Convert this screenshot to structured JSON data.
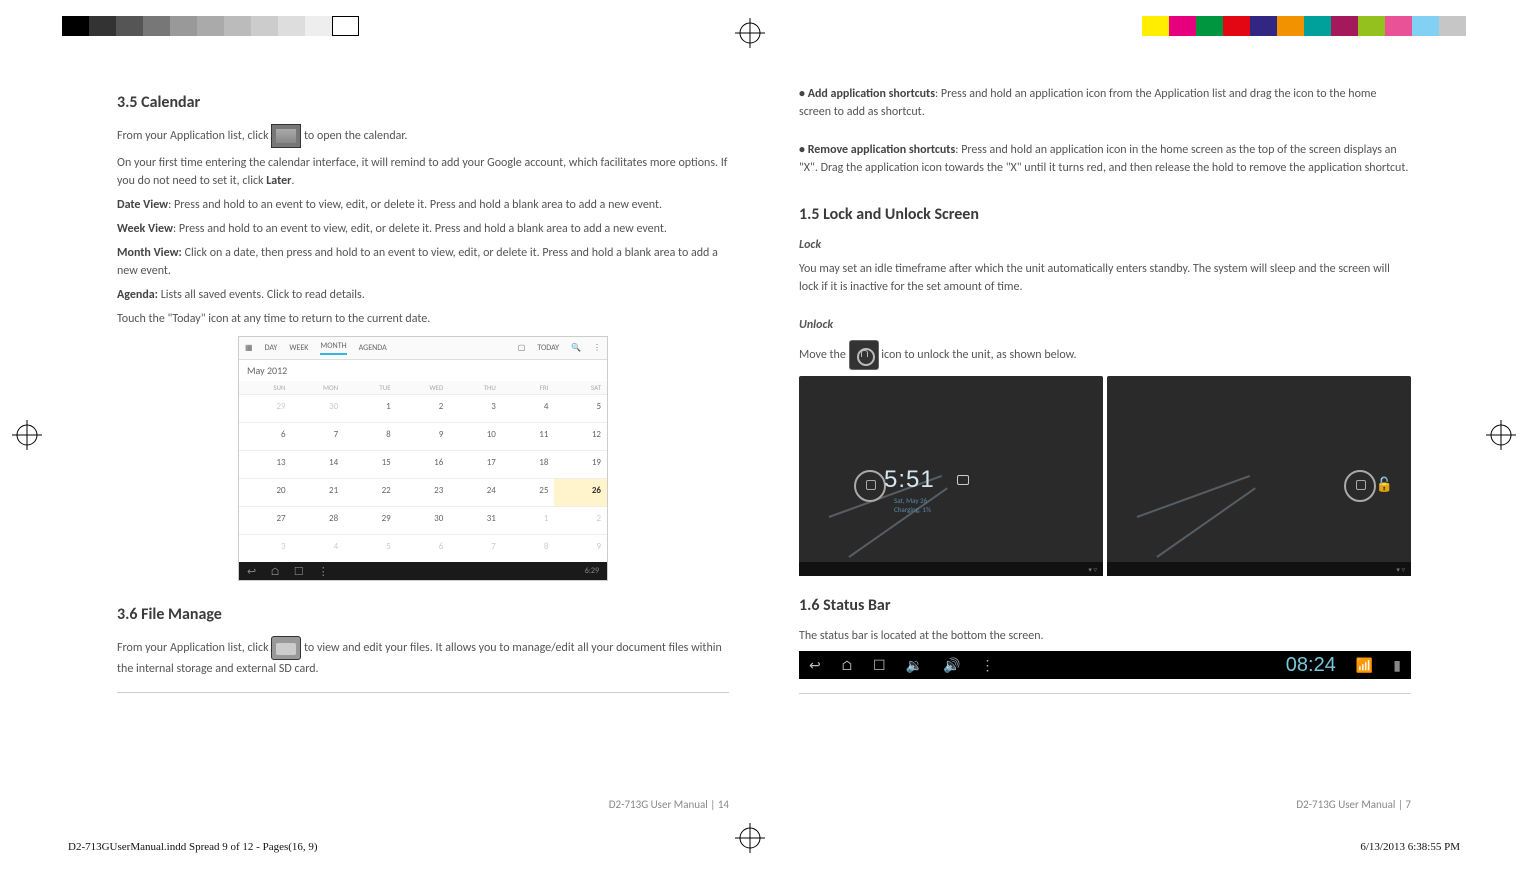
{
  "left": {
    "h_cal": "3.5 Calendar",
    "p1a": "From your Application list, click ",
    "p1b": " to open the calendar.",
    "p2": "On your first time entering the calendar interface, it will remind to add your Google account, which facilitates more options. If you do not need to set it, click ",
    "p2b": "Later",
    "dv_l": "Date View",
    "dv_t": ": Press and hold to an event to view, edit, or delete it. Press and hold a blank area to add a new event.",
    "wv_l": "Week View",
    "wv_t": ": Press and hold to an event to view, edit, or delete it. Press and hold a blank area to add a new event.",
    "mv_l": "Month View:",
    "mv_t": " Click on a date, then press and hold to an event to view, edit, or delete it. Press and hold a blank area to add a new event.",
    "ag_l": "Agenda:",
    "ag_t": " Lists all saved events. Click to read details.",
    "today": "Touch the \"Today\" icon at any time to return to the current date.",
    "cal_top": {
      "day": "DAY",
      "week": "WEEK",
      "month": "MONTH",
      "agenda": "AGENDA",
      "today": "TODAY"
    },
    "cal_month": "May 2012",
    "cal_hdrs": [
      "SUN",
      "MON",
      "TUE",
      "WED",
      "THU",
      "FRI",
      "SAT"
    ],
    "cal_cells": [
      {
        "v": "29",
        "dim": true
      },
      {
        "v": "30",
        "dim": true
      },
      {
        "v": "1"
      },
      {
        "v": "2"
      },
      {
        "v": "3"
      },
      {
        "v": "4"
      },
      {
        "v": "5"
      },
      {
        "v": "6"
      },
      {
        "v": "7"
      },
      {
        "v": "8"
      },
      {
        "v": "9"
      },
      {
        "v": "10"
      },
      {
        "v": "11"
      },
      {
        "v": "12"
      },
      {
        "v": "13"
      },
      {
        "v": "14"
      },
      {
        "v": "15"
      },
      {
        "v": "16"
      },
      {
        "v": "17"
      },
      {
        "v": "18"
      },
      {
        "v": "19"
      },
      {
        "v": "20"
      },
      {
        "v": "21"
      },
      {
        "v": "22"
      },
      {
        "v": "23"
      },
      {
        "v": "24"
      },
      {
        "v": "25"
      },
      {
        "v": "26",
        "hl": true
      },
      {
        "v": "27"
      },
      {
        "v": "28"
      },
      {
        "v": "29"
      },
      {
        "v": "30"
      },
      {
        "v": "31"
      },
      {
        "v": "1",
        "dim": true
      },
      {
        "v": "2",
        "dim": true
      },
      {
        "v": "3",
        "dim": true
      },
      {
        "v": "4",
        "dim": true
      },
      {
        "v": "5",
        "dim": true
      },
      {
        "v": "6",
        "dim": true
      },
      {
        "v": "7",
        "dim": true
      },
      {
        "v": "8",
        "dim": true
      },
      {
        "v": "9",
        "dim": true
      }
    ],
    "cal_nav_time": "6:29",
    "h_fm": "3.6  File Manage",
    "fm1a": "From your Application list, click ",
    "fm1b": " to view and edit your files. It allows you to manage/edit all your document files within the internal storage and external SD card.",
    "footer": "D2-713G User Manual | 14"
  },
  "right": {
    "add_l": "• Add application shortcuts",
    "add_t": ": Press and hold an application icon from the Application list and drag the icon to the home screen to add as shortcut.",
    "rem_l": "• Remove application shortcuts",
    "rem_t": ": Press and hold an application icon in the home screen as the top of the screen displays an \"X\". Drag the application icon towards the \"X\" until it turns red, and then release the hold to remove the application shortcut.",
    "h_lock": "1.5 Lock and Unlock Screen",
    "lock_l": "Lock",
    "lock_t": "You may set an idle timeframe after which the unit automatically enters standby. The system will sleep and the screen will lock if it is inactive for the set amount of time.",
    "unlock_l": "Unlock",
    "unlock_a": "Move the ",
    "unlock_b": " icon to unlock the unit, as shown below.",
    "clock": "5:51",
    "date": "Sat, May 26",
    "charging": "Charging, 1%",
    "h_status": "1.6 Status Bar",
    "status_t": "The status bar is located at the bottom the screen.",
    "status_time": "08:24",
    "footer": "D2-713G User Manual | 7"
  },
  "print": {
    "file": "D2-713GUserManual.indd   Spread 9 of 12 - Pages(16, 9)",
    "stamp": "6/13/2013   6:38:55 PM"
  },
  "colorbars": {
    "left": [
      "#000",
      "#333",
      "#555",
      "#777",
      "#999",
      "#aaa",
      "#bbb",
      "#ccc",
      "#ddd",
      "#eee",
      "#fff"
    ],
    "right": [
      "#ffee00",
      "#e6007e",
      "#009640",
      "#e30613",
      "#312783",
      "#f39200",
      "#00a19a",
      "#a3195b",
      "#95c11f",
      "#ea5297",
      "#83d0f5",
      "#c6c6c6"
    ]
  }
}
